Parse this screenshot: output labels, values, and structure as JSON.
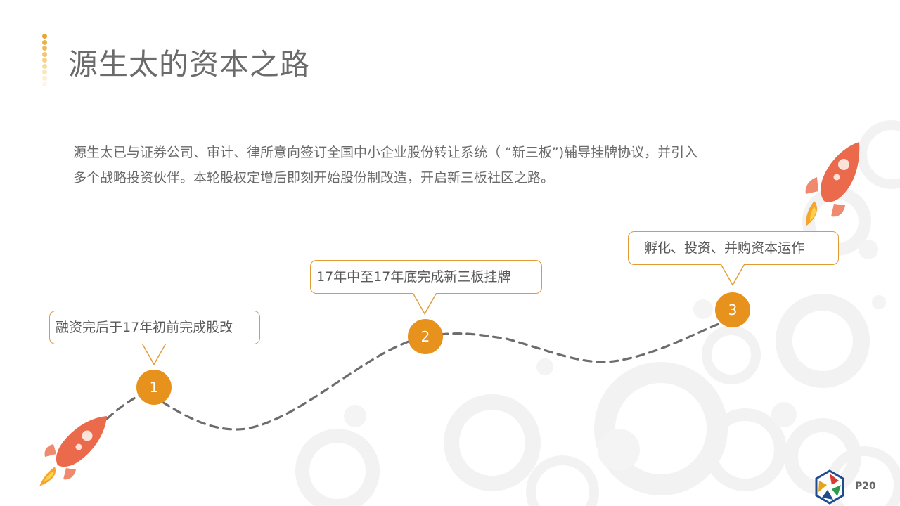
{
  "title": "源生太的资本之路",
  "body": {
    "line1": "源生太已与证券公司、审计、律所意向签订全国中小企业股份转让系统（ “新三板”)辅导挂牌协议，并引入",
    "line2": "多个战略投资伙伴。本轮股权定增后即刻开始股份制改造，开启新三板社区之路。"
  },
  "milestones": [
    {
      "number": "1",
      "label": "融资完后于17年初前完成股改"
    },
    {
      "number": "2",
      "label": "17年中至17年底完成新三板挂牌"
    },
    {
      "number": "3",
      "label": "孵化、投资、并购资本运作"
    }
  ],
  "page_number": "P20",
  "colors": {
    "accent": "#e6921c",
    "bubble_border": "#e29a34",
    "rocket": "#ec6a4c",
    "flame": "#f39a2a",
    "dashed_path": "#6d6d6d",
    "bg_rings": "#f3f3f3"
  },
  "icons": {
    "rocket": "rocket-icon",
    "logo": "company-logo-icon"
  }
}
